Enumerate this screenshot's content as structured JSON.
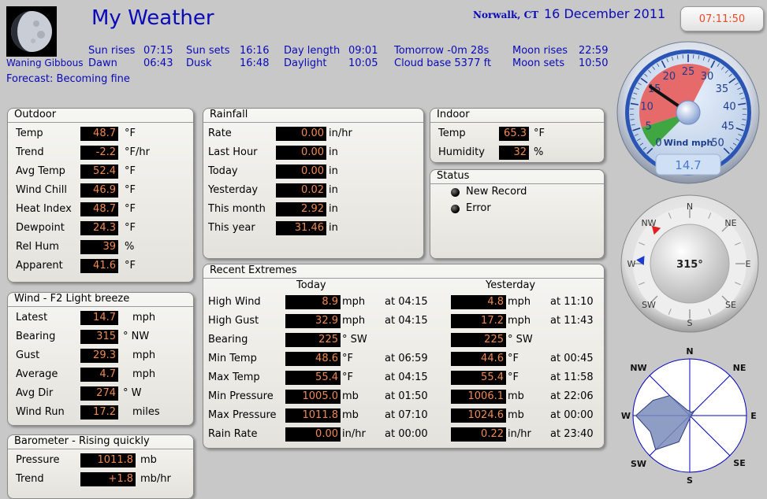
{
  "header": {
    "title": "My Weather",
    "location": "Norwalk, CT",
    "date": "16 December 2011",
    "time": "07:11:50",
    "moon_phase": "Waning Gibbous",
    "forecast_label": "Forecast:",
    "forecast": "Becoming fine"
  },
  "astro": {
    "sun_rises_label": "Sun rises",
    "sun_rises": "07:15",
    "dawn_label": "Dawn",
    "dawn": "06:43",
    "sun_sets_label": "Sun sets",
    "sun_sets": "16:16",
    "dusk_label": "Dusk",
    "dusk": "16:48",
    "day_length_label": "Day length",
    "day_length": "09:01",
    "daylight_label": "Daylight",
    "daylight": "10:05",
    "tomorrow": "Tomorrow -0m 28s",
    "cloud_base": "Cloud base 5377 ft",
    "moon_rises_label": "Moon rises",
    "moon_rises": "22:59",
    "moon_sets_label": "Moon sets",
    "moon_sets": "10:50"
  },
  "outdoor": {
    "title": "Outdoor",
    "rows": [
      {
        "label": "Temp",
        "value": "48.7",
        "unit": "°F"
      },
      {
        "label": "Trend",
        "value": "-2.2",
        "unit": "°F/hr"
      },
      {
        "label": "Avg Temp",
        "value": "52.4",
        "unit": "°F"
      },
      {
        "label": "Wind Chill",
        "value": "46.9",
        "unit": "°F"
      },
      {
        "label": "Heat Index",
        "value": "48.7",
        "unit": "°F"
      },
      {
        "label": "Dewpoint",
        "value": "24.3",
        "unit": "°F"
      },
      {
        "label": "Rel Hum",
        "value": "39",
        "unit": "%"
      },
      {
        "label": "Apparent",
        "value": "41.6",
        "unit": "°F"
      }
    ]
  },
  "wind": {
    "title": "Wind - F2 Light breeze",
    "rows": [
      {
        "label": "Latest",
        "value": "14.7",
        "unit": "mph"
      },
      {
        "label": "Bearing",
        "value": "315",
        "unit": "° NW"
      },
      {
        "label": "Gust",
        "value": "29.3",
        "unit": "mph"
      },
      {
        "label": "Average",
        "value": "4.7",
        "unit": "mph"
      },
      {
        "label": "Avg Dir",
        "value": "274",
        "unit": "° W"
      },
      {
        "label": "Wind Run",
        "value": "17.2",
        "unit": "miles"
      }
    ]
  },
  "barometer": {
    "title": "Barometer - Rising quickly",
    "rows": [
      {
        "label": "Pressure",
        "value": "1011.8",
        "unit": "mb"
      },
      {
        "label": "Trend",
        "value": "+1.8",
        "unit": "mb/hr"
      }
    ]
  },
  "rainfall": {
    "title": "Rainfall",
    "rows": [
      {
        "label": "Rate",
        "value": "0.00",
        "unit": "in/hr"
      },
      {
        "label": "Last Hour",
        "value": "0.00",
        "unit": "in"
      },
      {
        "label": "Today",
        "value": "0.00",
        "unit": "in"
      },
      {
        "label": "Yesterday",
        "value": "0.02",
        "unit": "in"
      },
      {
        "label": "This month",
        "value": "2.92",
        "unit": "in"
      },
      {
        "label": "This year",
        "value": "31.46",
        "unit": "in"
      }
    ]
  },
  "indoor": {
    "title": "Indoor",
    "rows": [
      {
        "label": "Temp",
        "value": "65.3",
        "unit": "°F"
      },
      {
        "label": "Humidity",
        "value": "32",
        "unit": "%"
      }
    ]
  },
  "status": {
    "title": "Status",
    "items": [
      "New Record",
      "Error"
    ]
  },
  "extremes": {
    "title": "Recent Extremes",
    "today_label": "Today",
    "yesterday_label": "Yesterday",
    "rows": [
      {
        "label": "High Wind",
        "today": "8.9",
        "today_unit": "mph",
        "today_time": "at 04:15",
        "yest": "4.8",
        "yest_unit": "mph",
        "yest_time": "at 11:10"
      },
      {
        "label": "High Gust",
        "today": "32.9",
        "today_unit": "mph",
        "today_time": "at 04:15",
        "yest": "17.2",
        "yest_unit": "mph",
        "yest_time": "at 11:43"
      },
      {
        "label": "Bearing",
        "today": "225",
        "today_unit": "°  SW",
        "today_time": "",
        "yest": "225",
        "yest_unit": "°  SW",
        "yest_time": ""
      },
      {
        "label": "Min Temp",
        "today": "48.6",
        "today_unit": "°F",
        "today_time": "at 06:59",
        "yest": "44.6",
        "yest_unit": "°F",
        "yest_time": "at 00:45"
      },
      {
        "label": "Max Temp",
        "today": "55.4",
        "today_unit": "°F",
        "today_time": "at 04:15",
        "yest": "55.4",
        "yest_unit": "°F",
        "yest_time": "at 11:58"
      },
      {
        "label": "Min Pressure",
        "today": "1005.0",
        "today_unit": "mb",
        "today_time": "at 01:50",
        "yest": "1006.1",
        "yest_unit": "mb",
        "yest_time": "at 22:06"
      },
      {
        "label": "Max Pressure",
        "today": "1011.8",
        "today_unit": "mb",
        "today_time": "at 07:10",
        "yest": "1024.6",
        "yest_unit": "mb",
        "yest_time": "at 00:00"
      },
      {
        "label": "Rain Rate",
        "today": "0.00",
        "today_unit": "in/hr",
        "today_time": "at 00:00",
        "yest": "0.22",
        "yest_unit": "in/hr",
        "yest_time": "at 23:40"
      }
    ]
  },
  "wind_gauge": {
    "label": "Wind mph",
    "ticks": [
      "0",
      "5",
      "10",
      "15",
      "20",
      "25",
      "30",
      "35",
      "40",
      "45",
      "50"
    ],
    "max": 50,
    "needle_value": 14.7,
    "green_max": 5,
    "red_max": 30,
    "digital": "14.7"
  },
  "compass": {
    "bearing_text": "315°",
    "bearing": 315,
    "avg_bearing": 274,
    "labels": {
      "n": "N",
      "ne": "NE",
      "e": "E",
      "se": "SE",
      "s": "S",
      "sw": "SW",
      "w": "W",
      "nw": "NW"
    }
  },
  "wind_rose": {
    "labels": {
      "n": "N",
      "ne": "NE",
      "e": "E",
      "se": "SE",
      "s": "S",
      "sw": "SW",
      "w": "W",
      "nw": "NW"
    },
    "directions": [
      0,
      22.5,
      45,
      67.5,
      90,
      112.5,
      135,
      157.5,
      180,
      202.5,
      225,
      247.5,
      270,
      292.5,
      315,
      337.5
    ],
    "fractions": [
      0.08,
      0.06,
      0.12,
      0.04,
      0.03,
      0.03,
      0.03,
      0.03,
      0.05,
      0.5,
      0.85,
      0.75,
      0.95,
      0.7,
      0.5,
      0.1
    ]
  },
  "colors": {
    "header_text": "#0a0ab8",
    "value_text": "#f08a50",
    "clock_text": "#e84a2a",
    "gauge_green": "#3fa642",
    "gauge_red": "#e66a6a",
    "rose_fill": "#7a8cb8"
  }
}
